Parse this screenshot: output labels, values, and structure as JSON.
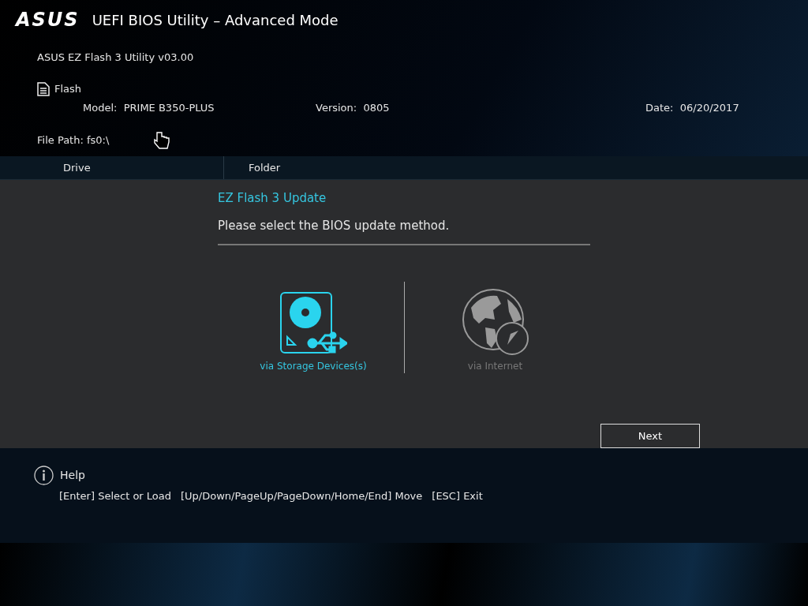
{
  "window": {
    "logo": "ASUS",
    "title": "UEFI BIOS Utility – Advanced Mode"
  },
  "utility": "ASUS EZ Flash 3 Utility v03.00",
  "section": "Flash",
  "info": [
    {
      "label": "Model:",
      "value": "PRIME B350-PLUS"
    },
    {
      "label": "Version:",
      "value": "0805"
    },
    {
      "label": "Date:",
      "value": "06/20/2017"
    }
  ],
  "file_path": "File Path: fs0:\\",
  "columns": [
    "Drive",
    "Folder"
  ],
  "dialog": {
    "title": "EZ Flash 3 Update",
    "prompt": "Please select the BIOS update method.",
    "methods": [
      {
        "kind": "storage",
        "label": "via Storage Devices(s)",
        "selected": true
      },
      {
        "kind": "internet",
        "label": "via Internet",
        "selected": false
      }
    ],
    "button": "Next"
  },
  "help": {
    "title": "Help",
    "keys": [
      "[Enter] Select or Load",
      "[Up/Down/PageUp/PageDown/Home/End] Move",
      "[ESC] Exit"
    ]
  }
}
